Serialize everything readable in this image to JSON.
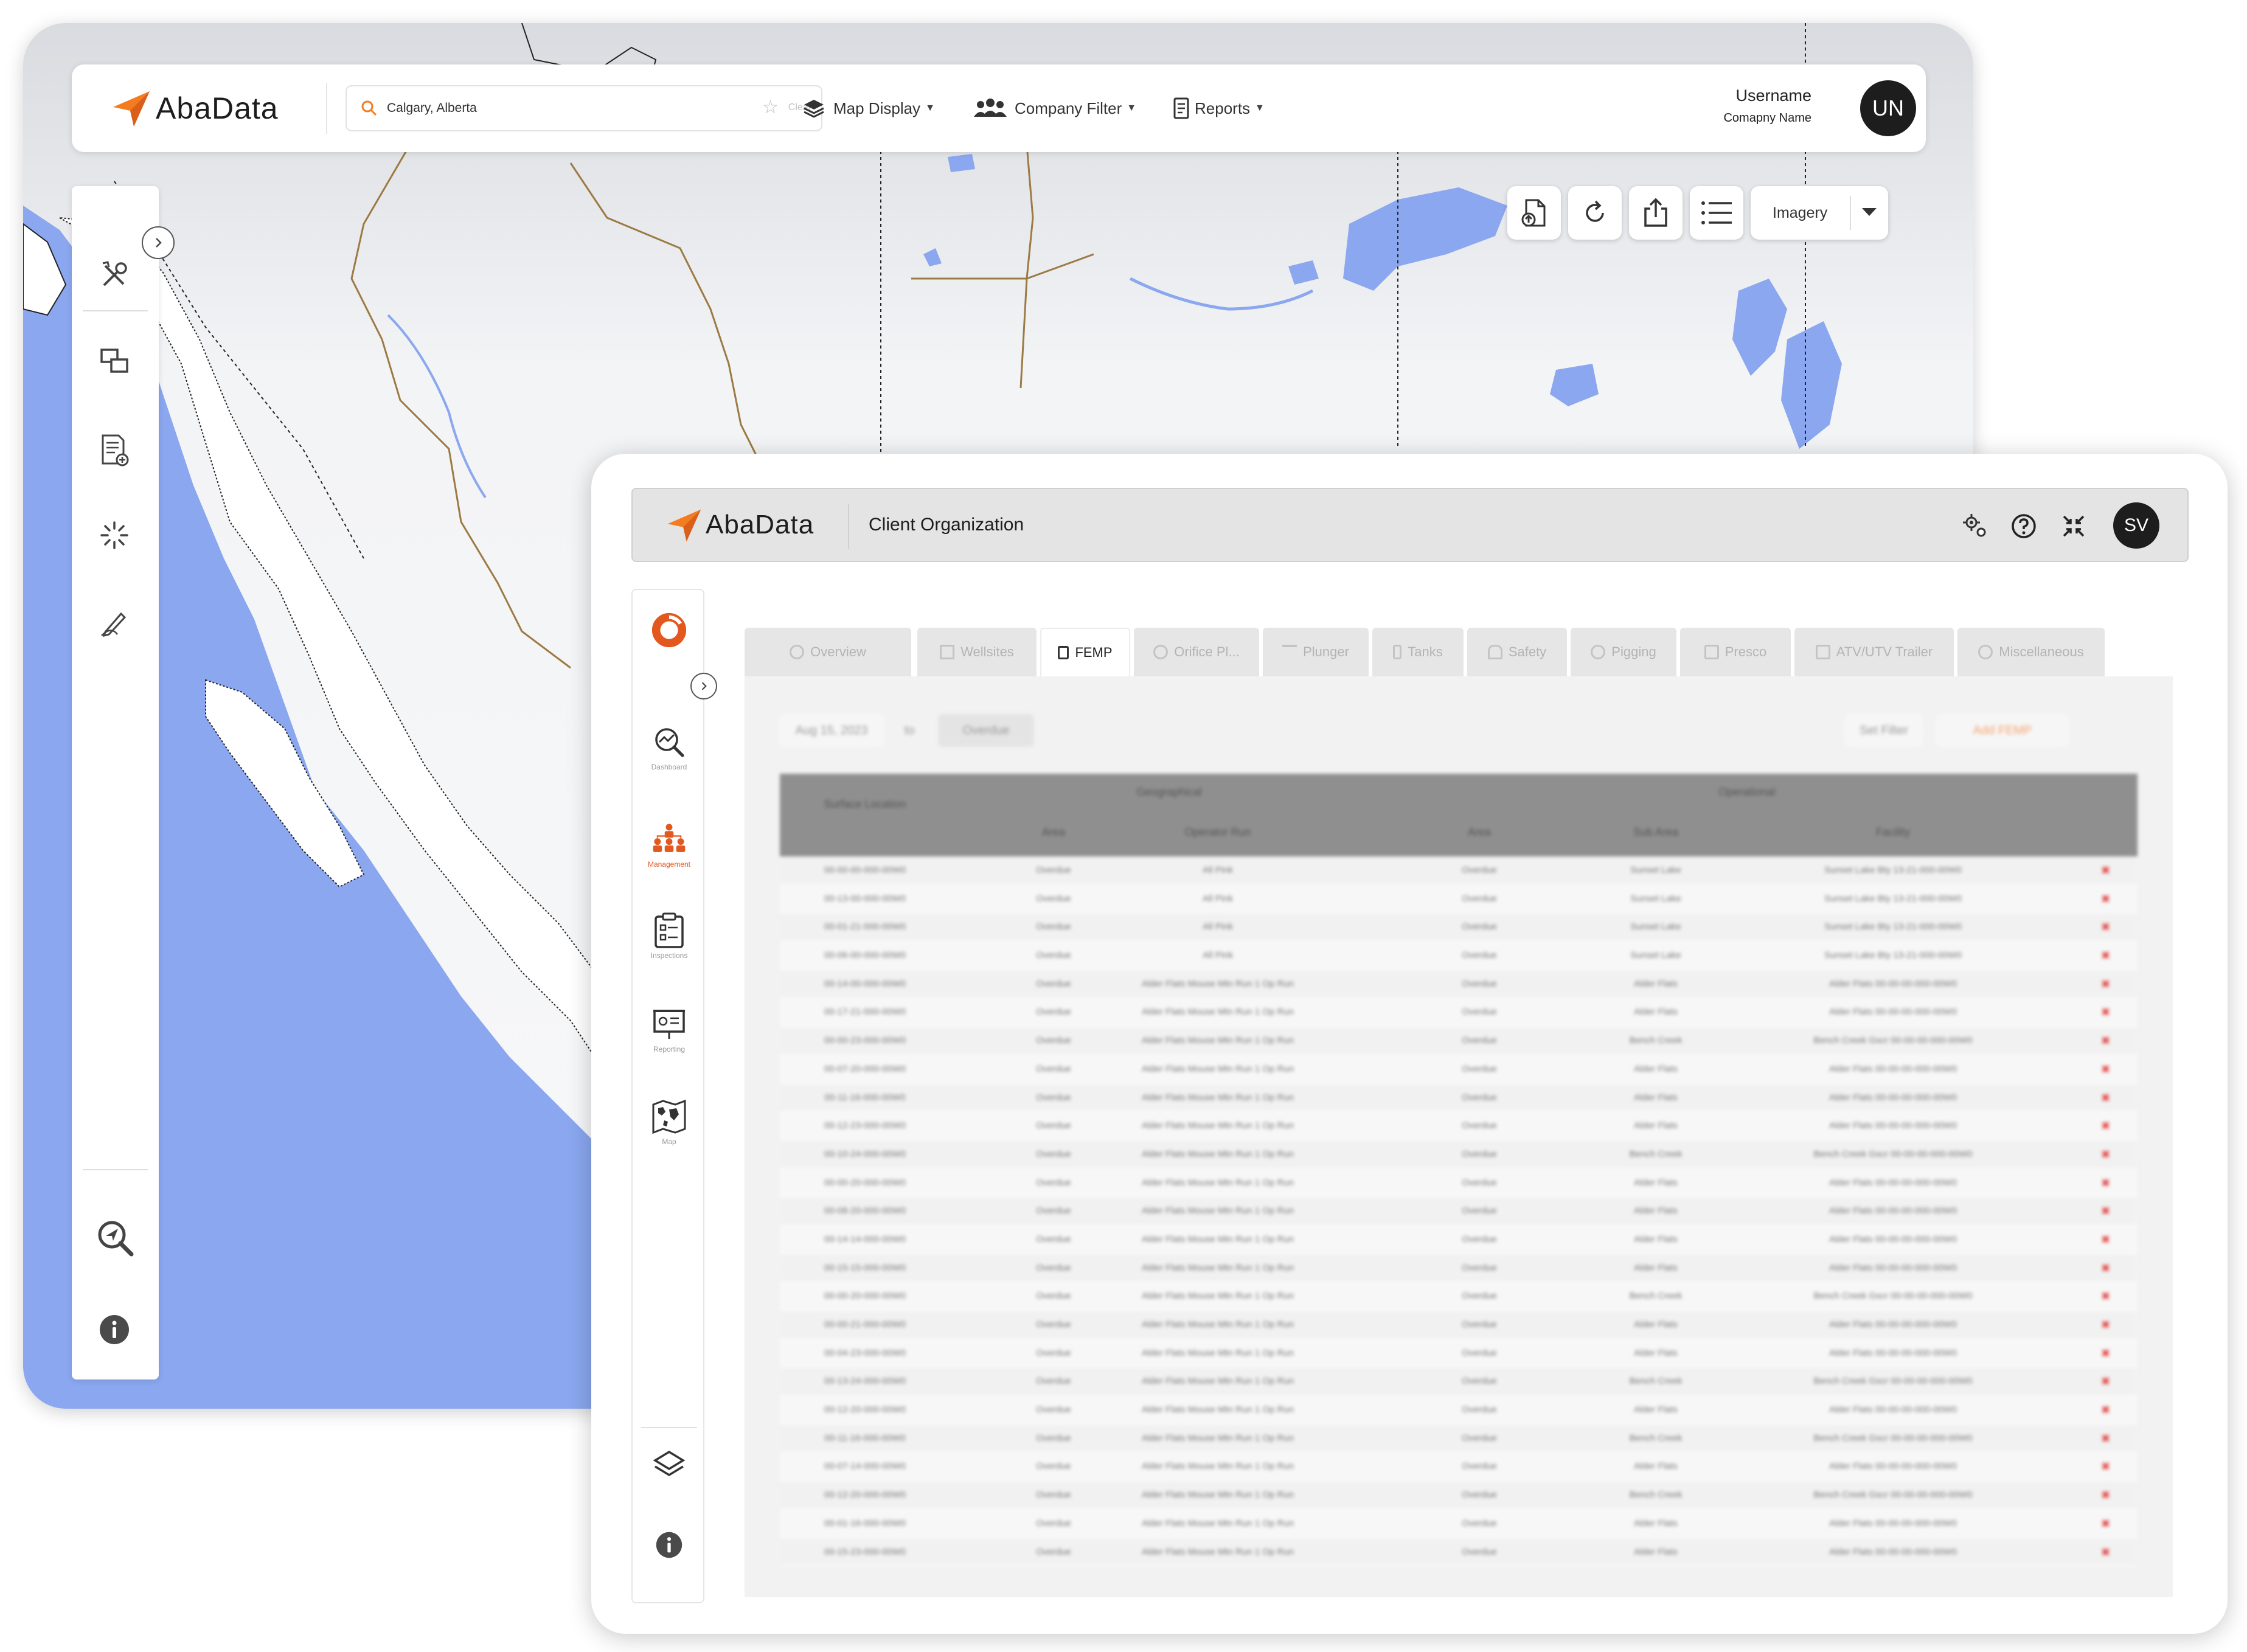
{
  "map_window": {
    "brand": "AbaData",
    "search": {
      "value": "Calgary, Alberta",
      "clear_label": "Clear"
    },
    "menu": {
      "map_display": "Map Display",
      "company_filter": "Company Filter",
      "reports": "Reports"
    },
    "user": {
      "username": "Username",
      "company": "Comapny Name",
      "initials": "UN"
    },
    "imagery": "Imagery",
    "colors": {
      "water": "#8aa7ef",
      "land": "#ffffff",
      "accent": "#f47b20"
    }
  },
  "app_window": {
    "brand": "AbaData",
    "organization": "Client Organization",
    "user_initials": "SV",
    "nav": [
      {
        "label": "Dashboard"
      },
      {
        "label": "Management"
      },
      {
        "label": "Inspections"
      },
      {
        "label": "Reporting"
      },
      {
        "label": "Map"
      }
    ],
    "tabs": [
      {
        "label": "Overview"
      },
      {
        "label": "Wellsites"
      },
      {
        "label": "FEMP"
      },
      {
        "label": "Orifice Pl..."
      },
      {
        "label": "Plunger"
      },
      {
        "label": "Tanks"
      },
      {
        "label": "Safety"
      },
      {
        "label": "Pigging"
      },
      {
        "label": "Presco"
      },
      {
        "label": "ATV/UTV Trailer"
      },
      {
        "label": "Miscellaneous"
      }
    ],
    "active_tab": "FEMP",
    "filters": {
      "date": "Aug 15, 2023",
      "to": "to",
      "status": "Overdue",
      "set_filter": "Set Filter",
      "add": "Add FEMP"
    },
    "table": {
      "group_headers": [
        "Geographical",
        "Operational"
      ],
      "columns": [
        "Surface Location",
        "Area",
        "Operator Run",
        "Area",
        "Sub Area",
        "Facility"
      ],
      "rows": [
        [
          "00-00-00-000-00W0",
          "Overdue",
          "All Pink",
          "Overdue",
          "Sunset Lake",
          "Sunset Lake Bty 13-21-000-00W0"
        ],
        [
          "00-13-00-000-00W0",
          "Overdue",
          "All Pink",
          "Overdue",
          "Sunset Lake",
          "Sunset Lake Bty 13-21-000-00W0"
        ],
        [
          "00-01-21-000-00W0",
          "Overdue",
          "All Pink",
          "Overdue",
          "Sunset Lake",
          "Sunset Lake Bty 13-21-000-00W0"
        ],
        [
          "00-06-00-000-00W0",
          "Overdue",
          "All Pink",
          "Overdue",
          "Sunset Lake",
          "Sunset Lake Bty 13-21-000-00W0"
        ],
        [
          "00-14-00-000-00W0",
          "Overdue",
          "Alder Flats Mouse Mtn Run 1 Op Run",
          "Overdue",
          "Alder Flats",
          "Alder Flats 00-00-00-000-00W0"
        ],
        [
          "00-17-21-000-00W0",
          "Overdue",
          "Alder Flats Mouse Mtn Run 1 Op Run",
          "Overdue",
          "Alder Flats",
          "Alder Flats 00-00-00-000-00W0"
        ],
        [
          "00-00-23-000-00W0",
          "Overdue",
          "Alder Flats Mouse Mtn Run 1 Op Run",
          "Overdue",
          "Bench Creek",
          "Bench Creek Gscr 00-00-00-000-00W0"
        ],
        [
          "00-07-20-000-00W0",
          "Overdue",
          "Alder Flats Mouse Mtn Run 1 Op Run",
          "Overdue",
          "Alder Flats",
          "Alder Flats 00-00-00-000-00W0"
        ],
        [
          "00-11-16-000-00W0",
          "Overdue",
          "Alder Flats Mouse Mtn Run 1 Op Run",
          "Overdue",
          "Alder Flats",
          "Alder Flats 00-00-00-000-00W0"
        ],
        [
          "00-12-23-000-00W0",
          "Overdue",
          "Alder Flats Mouse Mtn Run 1 Op Run",
          "Overdue",
          "Alder Flats",
          "Alder Flats 00-00-00-000-00W0"
        ],
        [
          "00-10-24-000-00W0",
          "Overdue",
          "Alder Flats Mouse Mtn Run 1 Op Run",
          "Overdue",
          "Bench Creek",
          "Bench Creek Gscr 00-00-00-000-00W0"
        ],
        [
          "00-00-20-000-00W0",
          "Overdue",
          "Alder Flats Mouse Mtn Run 1 Op Run",
          "Overdue",
          "Alder Flats",
          "Alder Flats 00-00-00-000-00W0"
        ],
        [
          "00-08-20-000-00W0",
          "Overdue",
          "Alder Flats Mouse Mtn Run 1 Op Run",
          "Overdue",
          "Alder Flats",
          "Alder Flats 00-00-00-000-00W0"
        ],
        [
          "00-14-14-000-00W0",
          "Overdue",
          "Alder Flats Mouse Mtn Run 1 Op Run",
          "Overdue",
          "Alder Flats",
          "Alder Flats 00-00-00-000-00W0"
        ],
        [
          "00-15-15-000-00W0",
          "Overdue",
          "Alder Flats Mouse Mtn Run 1 Op Run",
          "Overdue",
          "Alder Flats",
          "Alder Flats 00-00-00-000-00W0"
        ],
        [
          "00-00-20-000-00W0",
          "Overdue",
          "Alder Flats Mouse Mtn Run 1 Op Run",
          "Overdue",
          "Bench Creek",
          "Bench Creek Gscr 00-00-00-000-00W0"
        ],
        [
          "00-00-21-000-00W0",
          "Overdue",
          "Alder Flats Mouse Mtn Run 1 Op Run",
          "Overdue",
          "Alder Flats",
          "Alder Flats 00-00-00-000-00W0"
        ],
        [
          "00-04-23-000-00W0",
          "Overdue",
          "Alder Flats Mouse Mtn Run 1 Op Run",
          "Overdue",
          "Alder Flats",
          "Alder Flats 00-00-00-000-00W0"
        ],
        [
          "00-13-24-000-00W0",
          "Overdue",
          "Alder Flats Mouse Mtn Run 1 Op Run",
          "Overdue",
          "Bench Creek",
          "Bench Creek Gscr 00-00-00-000-00W0"
        ],
        [
          "00-12-20-000-00W0",
          "Overdue",
          "Alder Flats Mouse Mtn Run 1 Op Run",
          "Overdue",
          "Alder Flats",
          "Alder Flats 00-00-00-000-00W0"
        ],
        [
          "00-11-16-000-00W0",
          "Overdue",
          "Alder Flats Mouse Mtn Run 1 Op Run",
          "Overdue",
          "Bench Creek",
          "Bench Creek Gscr 00-00-00-000-00W0"
        ],
        [
          "00-07-14-000-00W0",
          "Overdue",
          "Alder Flats Mouse Mtn Run 1 Op Run",
          "Overdue",
          "Alder Flats",
          "Alder Flats 00-00-00-000-00W0"
        ],
        [
          "00-12-20-000-00W0",
          "Overdue",
          "Alder Flats Mouse Mtn Run 1 Op Run",
          "Overdue",
          "Bench Creek",
          "Bench Creek Gscr 00-00-00-000-00W0"
        ],
        [
          "00-01-16-000-00W0",
          "Overdue",
          "Alder Flats Mouse Mtn Run 1 Op Run",
          "Overdue",
          "Alder Flats",
          "Alder Flats 00-00-00-000-00W0"
        ],
        [
          "00-15-23-000-00W0",
          "Overdue",
          "Alder Flats Mouse Mtn Run 1 Op Run",
          "Overdue",
          "Alder Flats",
          "Alder Flats 00-00-00-000-00W0"
        ]
      ]
    }
  }
}
